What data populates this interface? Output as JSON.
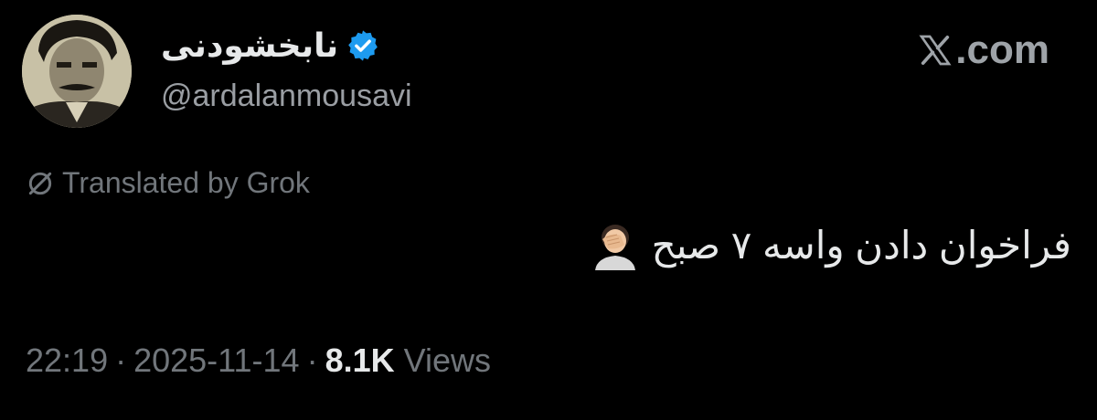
{
  "author": {
    "display_name": "نابخشودنی",
    "handle": "@ardalanmousavi",
    "verified": true,
    "avatar_icon": "avatar-photo"
  },
  "site": {
    "logo_icon": "x-logo-icon",
    "domain_suffix": ".com"
  },
  "translation": {
    "label": "Translated by Grok",
    "icon": "grok-icon"
  },
  "tweet": {
    "text": "فراخوان دادن واسه ۷ صبح",
    "emoji_icon": "facepalm-emoji-icon"
  },
  "meta": {
    "time": "22:19",
    "date": "2025-11-14",
    "separator": "·",
    "views_count": "8.1K",
    "views_label": "Views"
  },
  "colors": {
    "background": "#000000",
    "text_primary": "#e7e9ea",
    "text_secondary": "#71767b",
    "verified_blue": "#1d9bf0"
  }
}
